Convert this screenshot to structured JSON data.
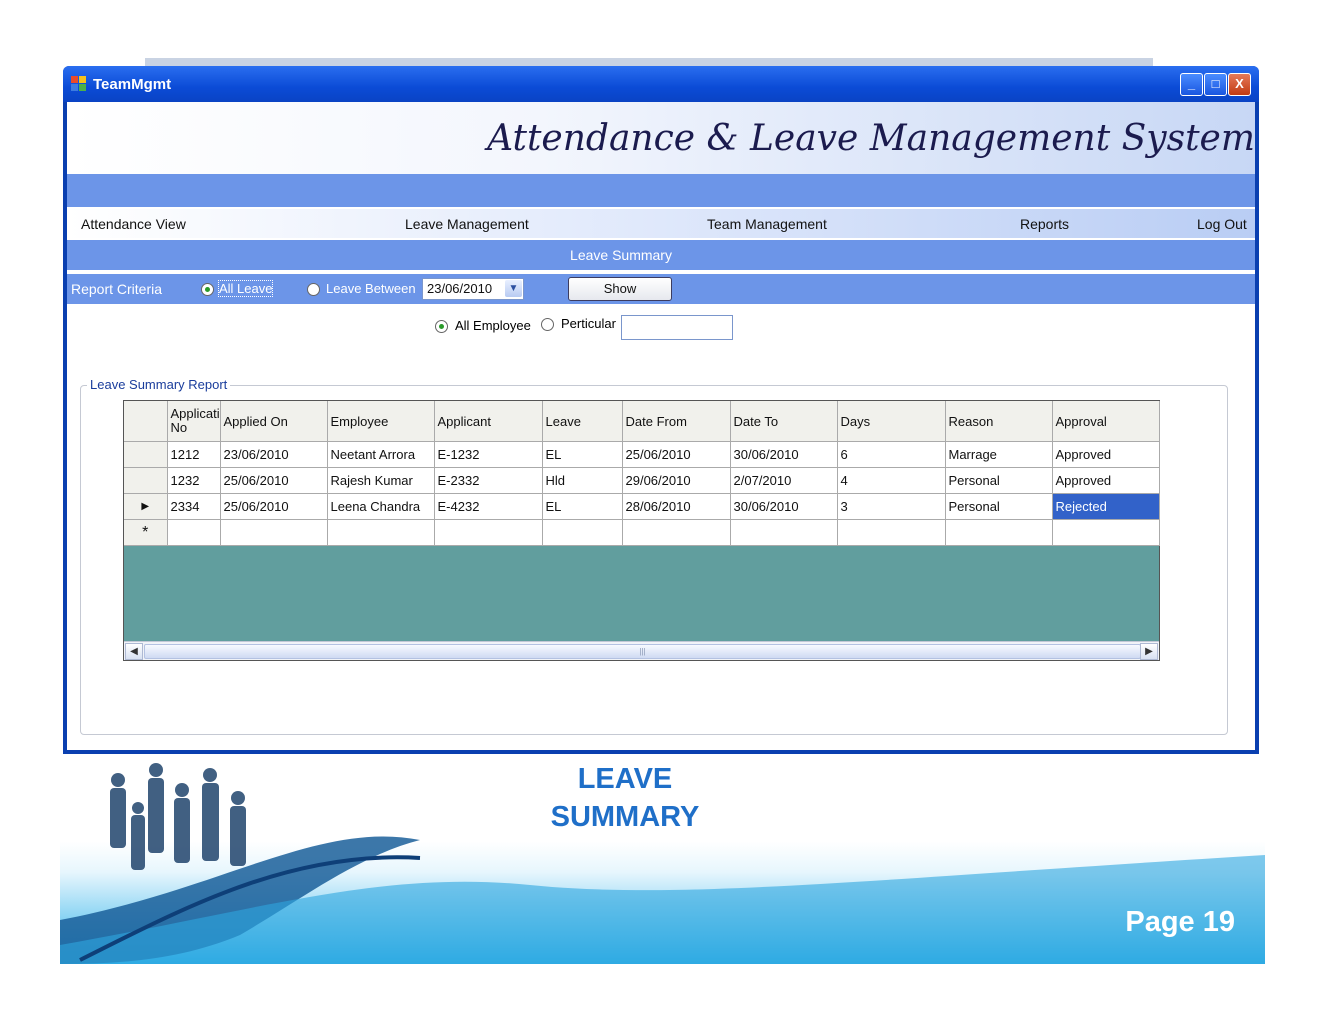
{
  "window": {
    "title": "TeamMgmt",
    "minimize": "_",
    "maximize": "□",
    "close": "X"
  },
  "banner": {
    "title": "Attendance & Leave Management System"
  },
  "menu": {
    "items": [
      "Attendance View",
      "Leave Management",
      "Team Management",
      "Reports",
      "Log Out"
    ]
  },
  "section_title": "Leave Summary",
  "criteria": {
    "label": "Report Criteria",
    "all_leave": "All Leave",
    "leave_between": "Leave Between",
    "date": "23/06/2010",
    "show": "Show",
    "all_employee": "All Employee",
    "particular": "Perticular",
    "particular_value": "",
    "selected_leave_option": "All Leave",
    "selected_employee_option": "All Employee"
  },
  "group": {
    "label": "Leave Summary Report"
  },
  "grid": {
    "columns": [
      "Applicati No",
      "Applied On",
      "Employee",
      "Applicant",
      "Leave",
      "Date From",
      "Date To",
      "Days",
      "Reason",
      "Approval"
    ],
    "rows": [
      [
        "1212",
        "23/06/2010",
        "Neetant Arrora",
        "E-1232",
        "EL",
        "25/06/2010",
        "30/06/2010",
        "6",
        "Marrage",
        "Approved"
      ],
      [
        "1232",
        "25/06/2010",
        "Rajesh Kumar",
        "E-2332",
        "Hld",
        "29/06/2010",
        "2/07/2010",
        "4",
        "Personal",
        "Approved"
      ],
      [
        "2334",
        "25/06/2010",
        "Leena Chandra",
        "E-4232",
        "EL",
        "28/06/2010",
        "30/06/2010",
        "3",
        "Personal",
        "Rejected"
      ]
    ],
    "current_row_marker": "▶",
    "new_row_marker": "*"
  },
  "slide": {
    "caption_line1": "LEAVE",
    "caption_line2": "SUMMARY",
    "page": "Page 19"
  }
}
